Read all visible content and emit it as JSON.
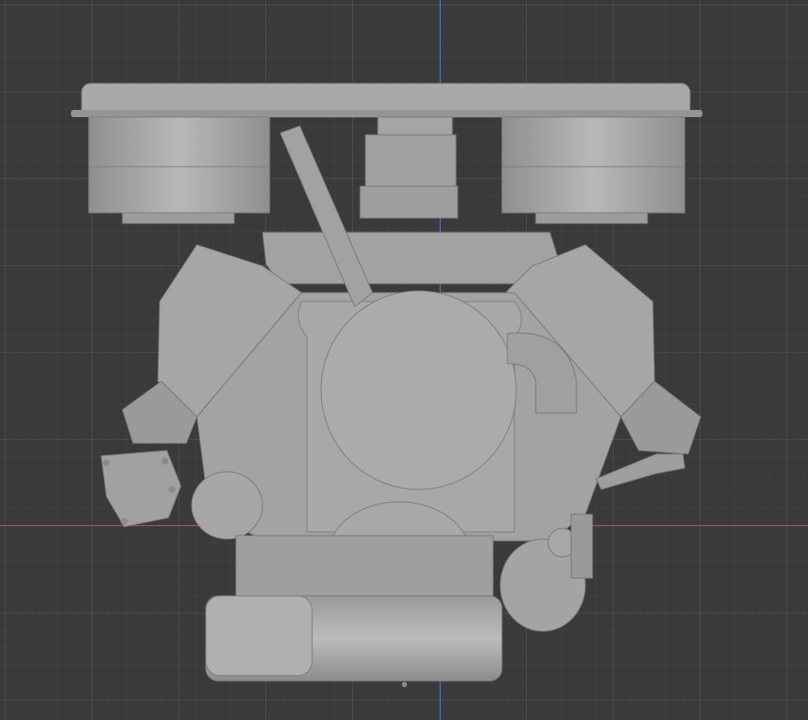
{
  "viewport": {
    "background": "#3a3a3a",
    "grid_minor": "rgba(255,255,255,0.03)",
    "grid_major": "rgba(255,255,255,0.06)"
  },
  "axes": {
    "x_axis_color": "#b0494e",
    "z_axis_color": "#4a73b0"
  },
  "model": {
    "shade_light": "#b5b5b5",
    "shade_mid": "#a3a3a3",
    "shade_dark": "#8a8a8a",
    "outline": "#6e6e6e"
  }
}
